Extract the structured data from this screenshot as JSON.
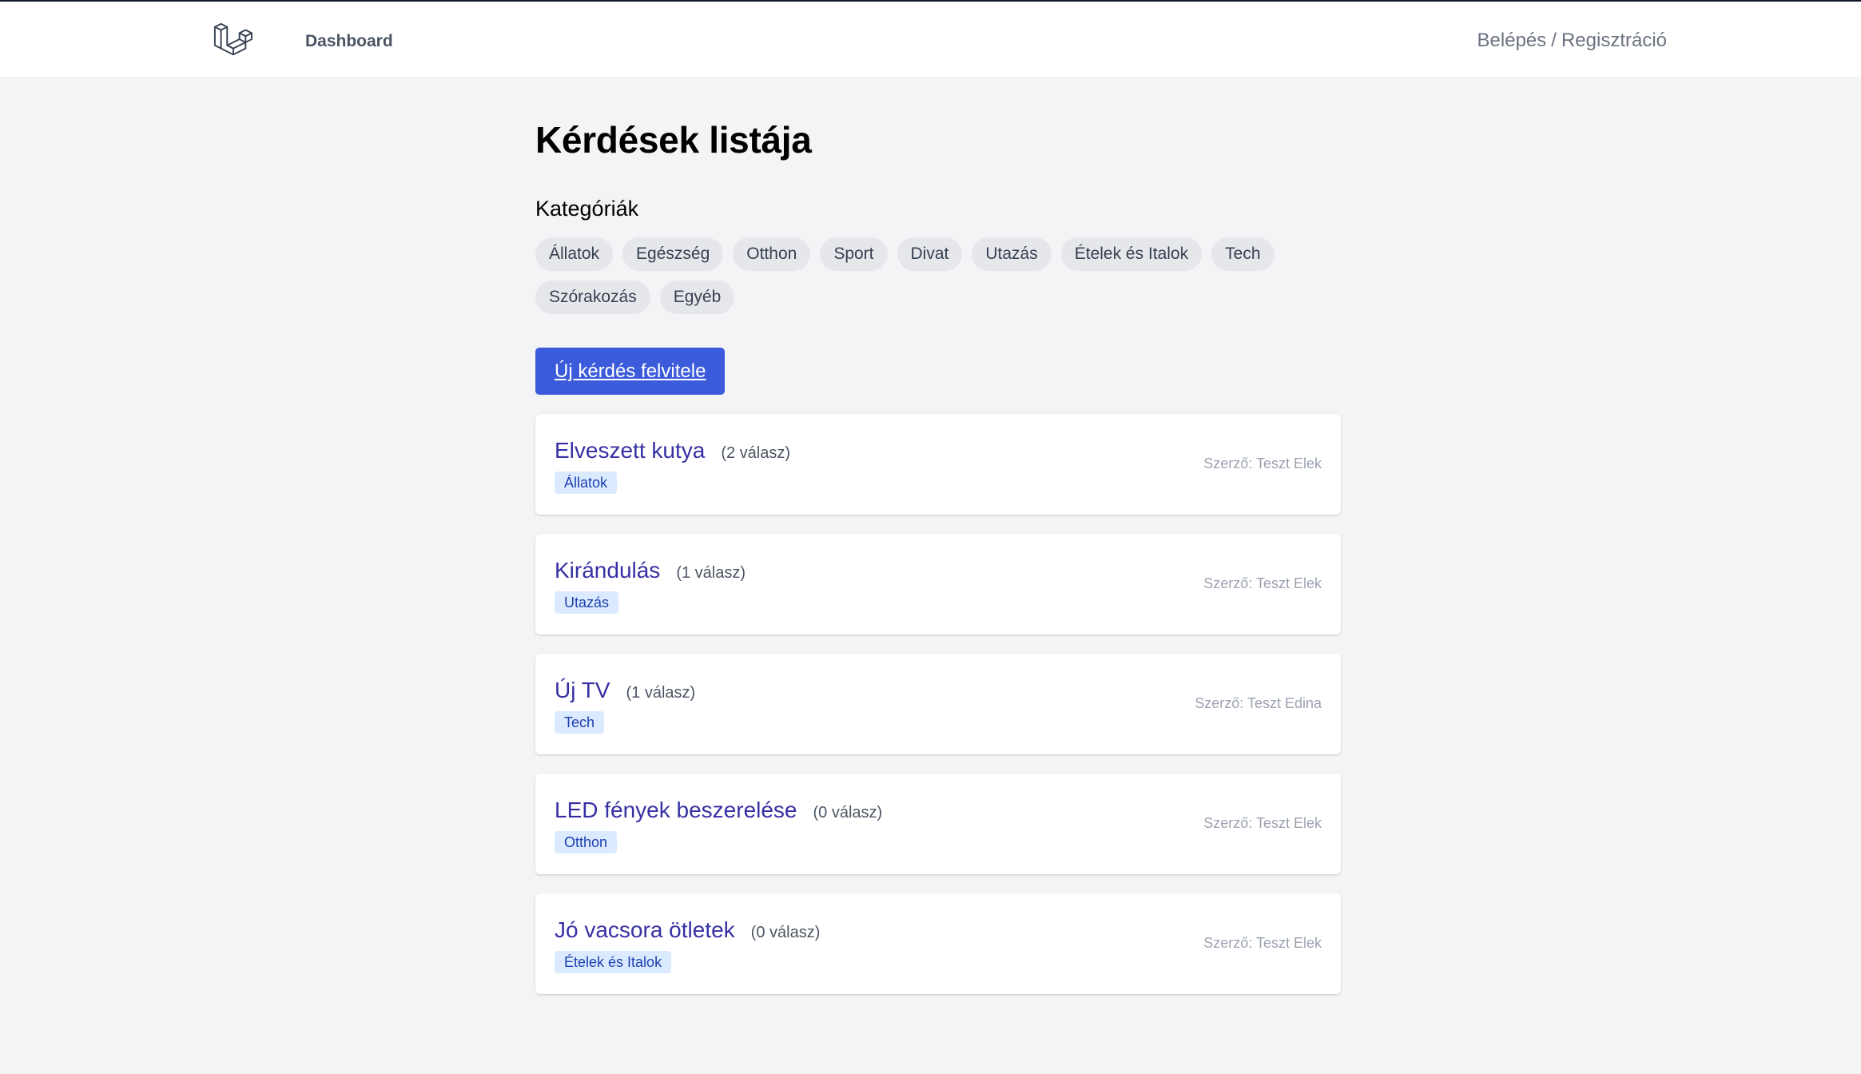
{
  "nav": {
    "logo": "laravel-logo-icon",
    "dashboard_label": "Dashboard",
    "login_label": "Belépés",
    "separator": "/",
    "register_label": "Regisztráció"
  },
  "page": {
    "title": "Kérdések listája",
    "categories_heading": "Kategóriák",
    "new_question_label": "Új kérdés felvitele"
  },
  "categories": [
    "Állatok",
    "Egészség",
    "Otthon",
    "Sport",
    "Divat",
    "Utazás",
    "Ételek és Italok",
    "Tech",
    "Szórakozás",
    "Egyéb"
  ],
  "questions": [
    {
      "title": "Elveszett kutya",
      "answers": "(2 válasz)",
      "category": "Állatok",
      "author": "Szerző: Teszt Elek"
    },
    {
      "title": "Kirándulás",
      "answers": "(1 válasz)",
      "category": "Utazás",
      "author": "Szerző: Teszt Elek"
    },
    {
      "title": "Új TV",
      "answers": "(1 válasz)",
      "category": "Tech",
      "author": "Szerző: Teszt Edina"
    },
    {
      "title": "LED fények beszerelése",
      "answers": "(0 válasz)",
      "category": "Otthon",
      "author": "Szerző: Teszt Elek"
    },
    {
      "title": "Jó vacsora ötletek",
      "answers": "(0 válasz)",
      "category": "Ételek és Italok",
      "author": "Szerző: Teszt Elek"
    }
  ],
  "colors": {
    "accent": "#3b5bdb",
    "link": "#3730a3",
    "background": "#f3f4f6"
  }
}
